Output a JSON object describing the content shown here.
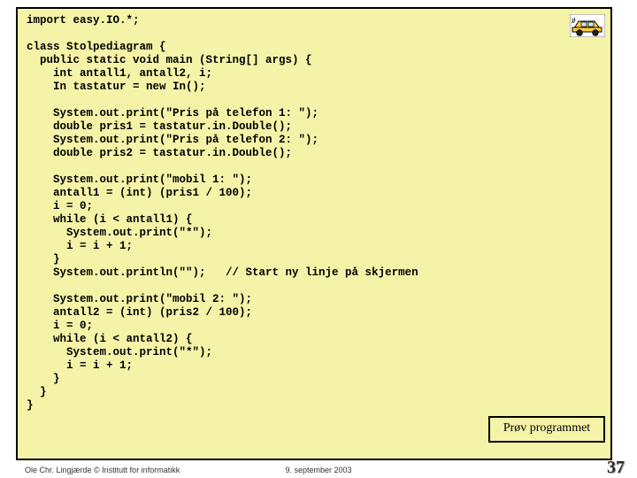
{
  "code": {
    "l01": "import easy.IO.*;",
    "l02": "",
    "l03": "class Stolpediagram {",
    "l04": "  public static void main (String[] args) {",
    "l05": "    int antall1, antall2, i;",
    "l06": "    In tastatur = new In();",
    "l07": "",
    "l08": "    System.out.print(\"Pris på telefon 1: \");",
    "l09": "    double pris1 = tastatur.in.Double();",
    "l10": "    System.out.print(\"Pris på telefon 2: \");",
    "l11": "    double pris2 = tastatur.in.Double();",
    "l12": "",
    "l13": "    System.out.print(\"mobil 1: \");",
    "l14": "    antall1 = (int) (pris1 / 100);",
    "l15": "    i = 0;",
    "l16": "    while (i < antall1) {",
    "l17": "      System.out.print(\"*\");",
    "l18": "      i = i + 1;",
    "l19": "    }",
    "l20": "    System.out.println(\"\");   // Start ny linje på skjermen",
    "l21": "",
    "l22": "    System.out.print(\"mobil 2: \");",
    "l23": "    antall2 = (int) (pris2 / 100);",
    "l24": "    i = 0;",
    "l25": "    while (i < antall2) {",
    "l26": "      System.out.print(\"*\");",
    "l27": "      i = i + 1;",
    "l28": "    }",
    "l29": "  }",
    "l30": "}"
  },
  "button": {
    "label": "Prøv programmet"
  },
  "footer": {
    "left": "Ole Chr. Lingjærde © Institutt for informatikk",
    "center": "9. september 2003"
  },
  "page": "37",
  "icon": {
    "name": "car-icon"
  }
}
